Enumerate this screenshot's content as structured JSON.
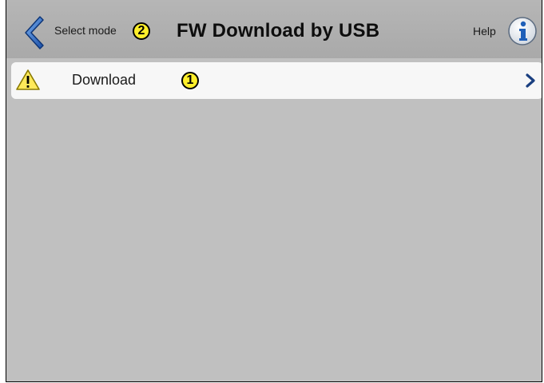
{
  "header": {
    "back_label": "Select mode",
    "title": "FW Download by USB",
    "help_label": "Help",
    "back_icon": "chevron-left-icon",
    "help_icon": "info-icon"
  },
  "callouts": {
    "header_marker": "2",
    "item_marker": "1"
  },
  "list": {
    "items": [
      {
        "label": "Download",
        "icon": "warning-icon",
        "trailing_icon": "chevron-right-icon"
      }
    ]
  },
  "colors": {
    "header_bg": "#aeaeae",
    "content_bg": "#c0c0c0",
    "accent_blue": "#1f5fb8",
    "callout_yellow": "#ffef2b",
    "warning_yellow": "#ffe95a"
  }
}
